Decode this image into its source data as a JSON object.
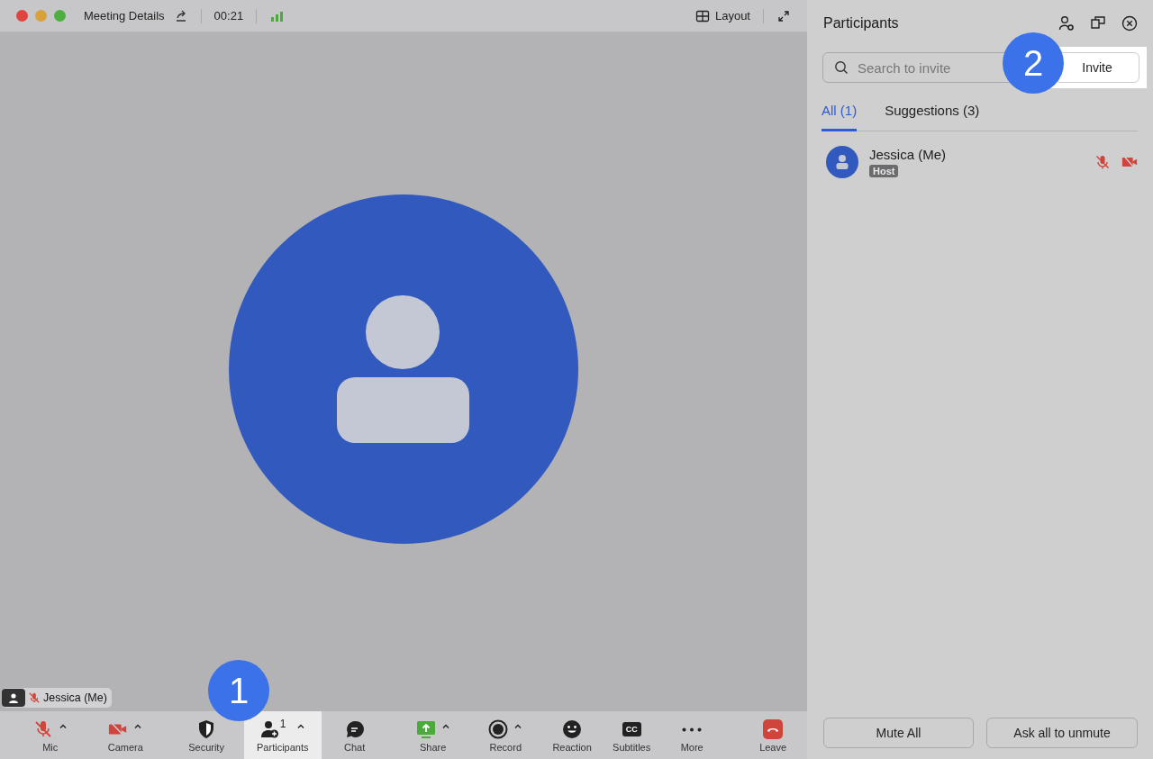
{
  "window": {
    "title": "Meeting Details",
    "timer": "00:21",
    "layout_button": "Layout"
  },
  "video": {
    "name_tag": "Jessica (Me)",
    "mic_off": true
  },
  "toolbar": [
    {
      "kind": "mic",
      "label": "Mic",
      "off": true,
      "has_menu": true,
      "highlighted": false
    },
    {
      "kind": "camera",
      "label": "Camera",
      "off": true,
      "has_menu": true,
      "highlighted": false
    },
    {
      "kind": "security",
      "label": "Security",
      "has_menu": false,
      "highlighted": false
    },
    {
      "kind": "participants",
      "label": "Participants",
      "count": "1",
      "has_menu": true,
      "highlighted": true
    },
    {
      "kind": "chat",
      "label": "Chat",
      "has_menu": false,
      "highlighted": false
    },
    {
      "kind": "share",
      "label": "Share",
      "has_menu": true,
      "highlighted": false
    },
    {
      "kind": "record",
      "label": "Record",
      "has_menu": true,
      "highlighted": false
    },
    {
      "kind": "reaction",
      "label": "Reaction",
      "has_menu": false,
      "highlighted": false
    },
    {
      "kind": "subtitles",
      "label": "Subtitles",
      "icon_text": "CC",
      "has_menu": false,
      "highlighted": false
    },
    {
      "kind": "more",
      "label": "More",
      "has_menu": false,
      "highlighted": false
    },
    {
      "kind": "leave",
      "label": "Leave",
      "has_menu": false,
      "highlighted": false
    }
  ],
  "panel": {
    "title": "Participants",
    "search": {
      "placeholder": "Search to invite"
    },
    "invite_button": "Invite",
    "tabs": [
      {
        "label": "All (1)",
        "selected": true
      },
      {
        "label": "Suggestions (3)",
        "selected": false
      }
    ],
    "participants": [
      {
        "name": "Jessica (Me)",
        "role": "Host",
        "mic_off": true,
        "camera_off": true
      }
    ],
    "buttons": [
      "Mute All",
      "Ask all to unmute"
    ]
  },
  "callouts": [
    {
      "number": "1"
    },
    {
      "number": "2"
    }
  ]
}
